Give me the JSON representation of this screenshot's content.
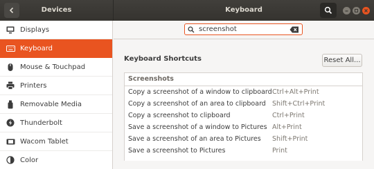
{
  "header": {
    "left_title": "Devices",
    "title": "Keyboard"
  },
  "sidebar": {
    "items": [
      {
        "label": "Displays",
        "icon": "display-icon",
        "active": false
      },
      {
        "label": "Keyboard",
        "icon": "keyboard-icon",
        "active": true
      },
      {
        "label": "Mouse & Touchpad",
        "icon": "mouse-icon",
        "active": false
      },
      {
        "label": "Printers",
        "icon": "printer-icon",
        "active": false
      },
      {
        "label": "Removable Media",
        "icon": "usb-drive-icon",
        "active": false
      },
      {
        "label": "Thunderbolt",
        "icon": "thunderbolt-icon",
        "active": false
      },
      {
        "label": "Wacom Tablet",
        "icon": "tablet-icon",
        "active": false
      },
      {
        "label": "Color",
        "icon": "color-icon",
        "active": false
      }
    ]
  },
  "search": {
    "value": "screenshot"
  },
  "shortcuts": {
    "title": "Keyboard Shortcuts",
    "reset_label": "Reset All...",
    "group": "Screenshots",
    "rows": [
      {
        "action": "Copy a screenshot of a window to clipboard",
        "accel": "Ctrl+Alt+Print"
      },
      {
        "action": "Copy a screenshot of an area to clipboard",
        "accel": "Shift+Ctrl+Print"
      },
      {
        "action": "Copy a screenshot to clipboard",
        "accel": "Ctrl+Print"
      },
      {
        "action": "Save a screenshot of a window to Pictures",
        "accel": "Alt+Print"
      },
      {
        "action": "Save a screenshot of an area to Pictures",
        "accel": "Shift+Print"
      },
      {
        "action": "Save a screenshot to Pictures",
        "accel": "Print"
      }
    ]
  },
  "colors": {
    "accent": "#e95420",
    "headerbar": "#3a3834"
  }
}
